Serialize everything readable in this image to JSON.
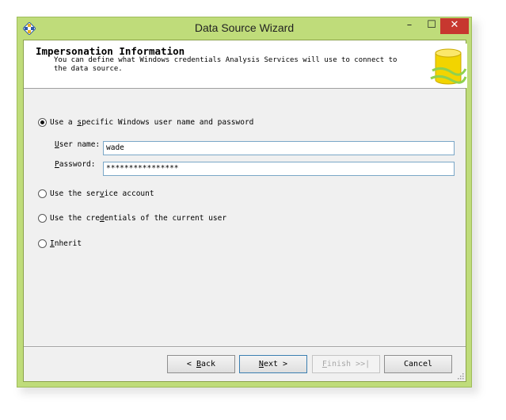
{
  "window": {
    "title": "Data Source Wizard",
    "minimize_glyph": "–",
    "maximize_glyph": "☐",
    "close_glyph": "✕"
  },
  "header": {
    "title": "Impersonation Information",
    "description": "You can define what Windows credentials Analysis Services will use to connect to the data source."
  },
  "options": [
    {
      "pre": "Use a ",
      "key": "s",
      "post": "pecific Windows user name and password",
      "checked": true
    },
    {
      "pre": "Use the ser",
      "key": "v",
      "post": "ice account",
      "checked": false
    },
    {
      "pre": "Use the cre",
      "key": "d",
      "post": "entials of the current user",
      "checked": false
    },
    {
      "pre": "",
      "key": "I",
      "post": "nherit",
      "checked": false
    }
  ],
  "credentials": {
    "username_label_key": "U",
    "username_label_rest": "ser name:",
    "username_value": "wade",
    "password_label_key": "P",
    "password_label_rest": "assword:",
    "password_value": "****************"
  },
  "buttons": {
    "back_pre": "< ",
    "back_key": "B",
    "back_rest": "ack",
    "next_key": "N",
    "next_rest": "ext >",
    "finish_key": "F",
    "finish_rest": "inish >>|",
    "cancel": "Cancel"
  },
  "colors": {
    "title_bar": "#bfdc7a",
    "close_button": "#c7372f",
    "dialog_bg": "#f0f0f0"
  }
}
